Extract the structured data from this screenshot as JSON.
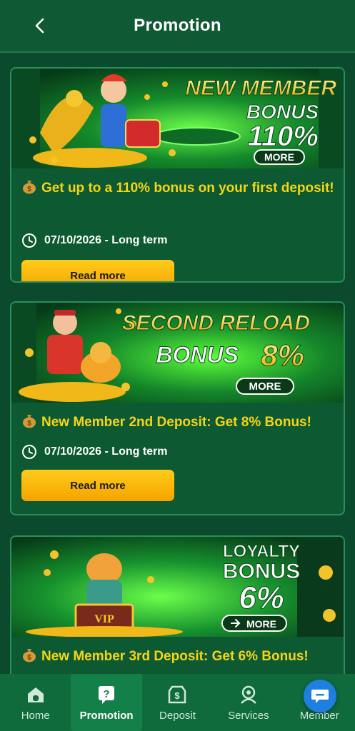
{
  "header": {
    "title": "Promotion"
  },
  "promotions": [
    {
      "banner": {
        "line1": "NEW MEMBER",
        "line2": "BONUS",
        "line3": "110%",
        "more": "MORE"
      },
      "title": "Get up to a 110% bonus on your first deposit!",
      "date": "07/10/2026 - Long term",
      "button": "Read more"
    },
    {
      "banner": {
        "line1": "SECOND RELOAD",
        "line2": "BONUS",
        "line3": "8%",
        "more": "MORE"
      },
      "title": "New Member 2nd Deposit: Get 8% Bonus!",
      "date": "07/10/2026 - Long term",
      "button": "Read more"
    },
    {
      "banner": {
        "line1": "LOYALTY",
        "line2": "BONUS",
        "line3": "6%",
        "more": "MORE",
        "badge": "VIP"
      },
      "title": "New Member 3rd Deposit: Get 6% Bonus!"
    }
  ],
  "tabs": [
    {
      "label": "Home",
      "icon": "home-icon"
    },
    {
      "label": "Promotion",
      "icon": "promotion-icon",
      "active": true
    },
    {
      "label": "Deposit",
      "icon": "deposit-icon"
    },
    {
      "label": "Services",
      "icon": "services-icon"
    },
    {
      "label": "Member",
      "icon": "member-icon"
    }
  ],
  "colors": {
    "background": "#0b4a2c",
    "header": "#0f5a34",
    "card": "#0d5a32",
    "card_border": "#2a8f5b",
    "title_yellow": "#f5d417",
    "button_gold": "#ffcc1a",
    "tab_active": "#148049",
    "chat_blue": "#1e7fe0"
  }
}
